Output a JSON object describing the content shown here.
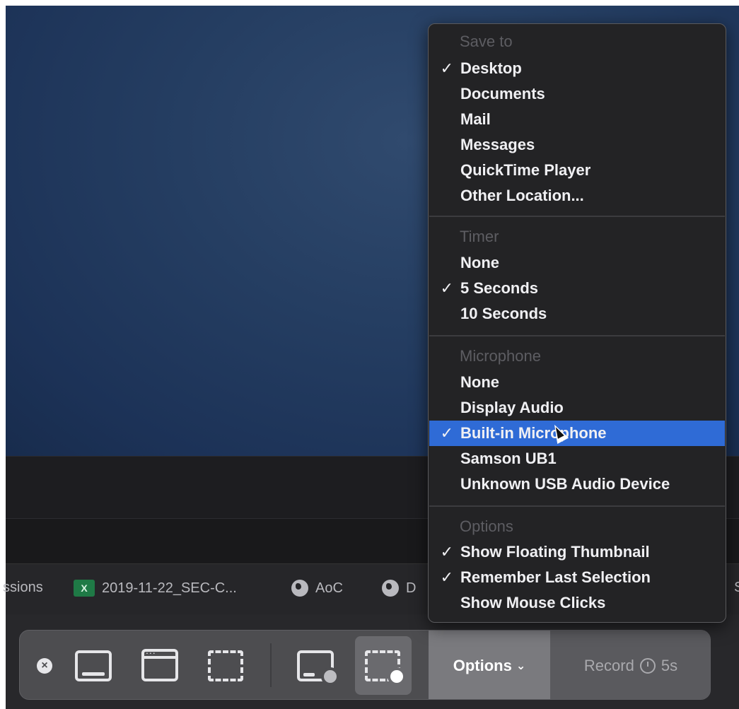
{
  "menu": {
    "save_to": {
      "header": "Save to",
      "items": [
        {
          "label": "Desktop",
          "checked": true
        },
        {
          "label": "Documents",
          "checked": false
        },
        {
          "label": "Mail",
          "checked": false
        },
        {
          "label": "Messages",
          "checked": false
        },
        {
          "label": "QuickTime Player",
          "checked": false
        },
        {
          "label": "Other Location...",
          "checked": false
        }
      ]
    },
    "timer": {
      "header": "Timer",
      "items": [
        {
          "label": "None",
          "checked": false
        },
        {
          "label": "5 Seconds",
          "checked": true
        },
        {
          "label": "10 Seconds",
          "checked": false
        }
      ]
    },
    "microphone": {
      "header": "Microphone",
      "items": [
        {
          "label": "None",
          "checked": false
        },
        {
          "label": "Display Audio",
          "checked": false
        },
        {
          "label": "Built-in Microphone",
          "checked": true,
          "highlighted": true
        },
        {
          "label": "Samson UB1",
          "checked": false
        },
        {
          "label": "Unknown USB Audio Device",
          "checked": false
        }
      ]
    },
    "options": {
      "header": "Options",
      "items": [
        {
          "label": "Show Floating Thumbnail",
          "checked": true
        },
        {
          "label": "Remember Last Selection",
          "checked": true
        },
        {
          "label": "Show Mouse Clicks",
          "checked": false
        }
      ]
    },
    "check_glyph": "✓"
  },
  "bookmarks": {
    "items": [
      {
        "label": "ssions",
        "icon": "none"
      },
      {
        "label": "2019-11-22_SEC-C...",
        "icon": "excel-icon",
        "icon_text": "X"
      },
      {
        "label": "AoC",
        "icon": "globe-icon"
      },
      {
        "label": "D",
        "icon": "globe-icon"
      },
      {
        "label": "S",
        "icon": "none"
      }
    ]
  },
  "toolbar": {
    "close_glyph": "×",
    "options_label": "Options",
    "options_chevron": "⌄",
    "record_label": "Record",
    "record_timer": "5s"
  },
  "colors": {
    "highlight": "#2f6bd6",
    "menu_bg": "#232325",
    "toolbar_bg": "#4d4d50"
  }
}
